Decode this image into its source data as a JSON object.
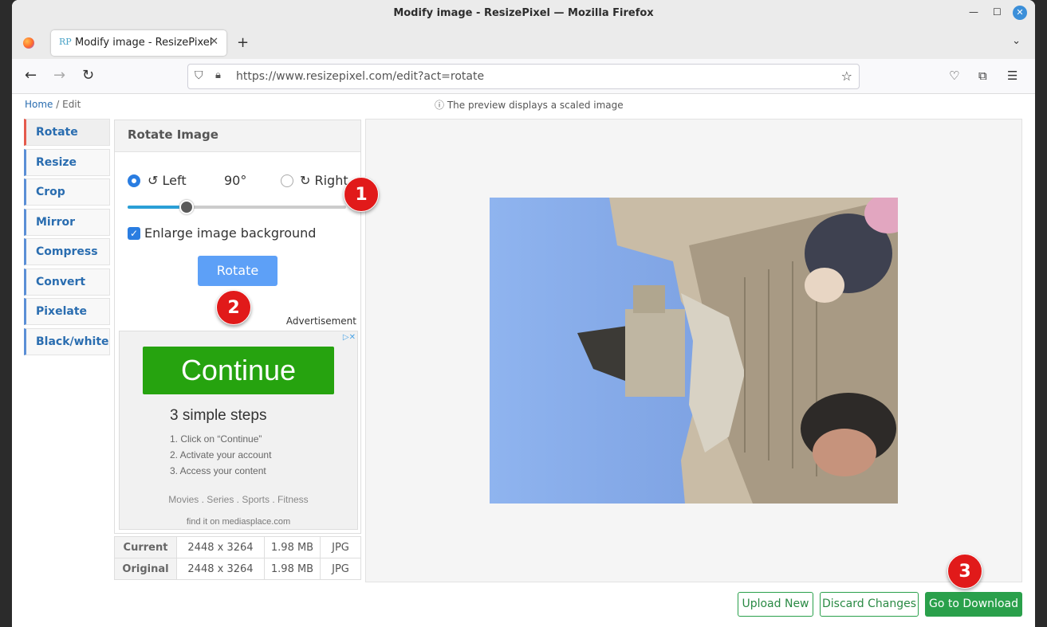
{
  "window": {
    "title": "Modify image - ResizePixel — Mozilla Firefox"
  },
  "tab": {
    "favicon": "RP",
    "label": "Modify image - ResizePixel"
  },
  "url": "https://www.resizepixel.com/edit?act=rotate",
  "breadcrumb": {
    "home": "Home",
    "sep": " / ",
    "current": "Edit"
  },
  "preview_note": "ⓘ The preview displays a scaled image",
  "menu": {
    "items": [
      {
        "label": "Rotate"
      },
      {
        "label": "Resize"
      },
      {
        "label": "Crop"
      },
      {
        "label": "Mirror"
      },
      {
        "label": "Compress"
      },
      {
        "label": "Convert"
      },
      {
        "label": "Pixelate"
      },
      {
        "label": "Black/white"
      }
    ],
    "active": "Rotate"
  },
  "panel": {
    "title": "Rotate Image",
    "left_label": "↺ Left",
    "angle": "90°",
    "right_label": "↻ Right",
    "selected_direction": "Left",
    "slider_fraction": 0.27,
    "enlarge_label": "Enlarge image background",
    "enlarge_checked": true,
    "rotate_button": "Rotate"
  },
  "ad": {
    "label": "Advertisement",
    "cta": "Continue",
    "heading": "3 simple steps",
    "steps": [
      "1. Click on “Continue”",
      "2. Activate your account",
      "3. Access your content"
    ],
    "categories": "Movies  .  Series  .  Sports  .  Fitness",
    "footer": "find it on mediasplace.com"
  },
  "info": {
    "rows": [
      {
        "label": "Current",
        "dims": "2448 x 3264",
        "size": "1.98 MB",
        "format": "JPG"
      },
      {
        "label": "Original",
        "dims": "2448 x 3264",
        "size": "1.98 MB",
        "format": "JPG"
      }
    ]
  },
  "actions": {
    "upload": "Upload New",
    "discard": "Discard Changes",
    "download": "Go to Download"
  },
  "badges": [
    "1",
    "2",
    "3"
  ],
  "colors": {
    "accent_blue": "#2a7de1",
    "green": "#2aa04b",
    "badge_red": "#e11a1a",
    "menu_active": "#e55b4d"
  }
}
